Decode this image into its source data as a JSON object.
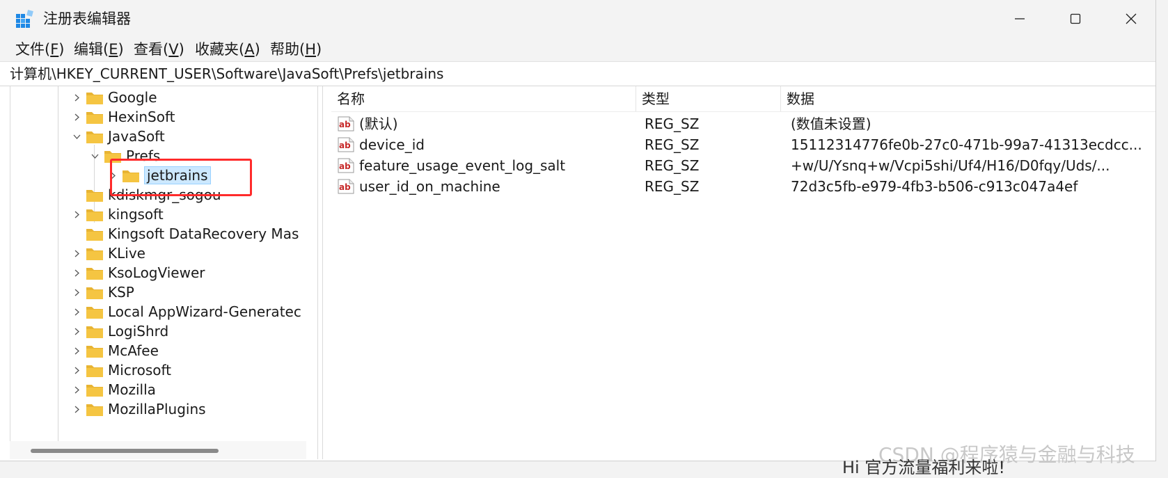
{
  "window": {
    "title": "注册表编辑器",
    "controls": {
      "minimize": "minimize",
      "maximize": "maximize",
      "close": "close"
    }
  },
  "menu": [
    {
      "label": "文件(",
      "key": "F",
      "end": ")"
    },
    {
      "label": "编辑(",
      "key": "E",
      "end": ")"
    },
    {
      "label": "查看(",
      "key": "V",
      "end": ")"
    },
    {
      "label": "收藏夹(",
      "key": "A",
      "end": ")"
    },
    {
      "label": "帮助(",
      "key": "H",
      "end": ")"
    }
  ],
  "address": "计算机\\HKEY_CURRENT_USER\\Software\\JavaSoft\\Prefs\\jetbrains",
  "tree": [
    {
      "label": "Google",
      "expander": "collapsed",
      "level": 0,
      "selected": false
    },
    {
      "label": "HexinSoft",
      "expander": "collapsed",
      "level": 0,
      "selected": false
    },
    {
      "label": "JavaSoft",
      "expander": "expanded",
      "level": 0,
      "selected": false
    },
    {
      "label": "Prefs",
      "expander": "expanded",
      "level": 1,
      "selected": false
    },
    {
      "label": "jetbrains",
      "expander": "collapsed",
      "level": 2,
      "selected": true
    },
    {
      "label": "kdiskmgr_sogou",
      "expander": "none",
      "level": 0,
      "selected": false
    },
    {
      "label": "kingsoft",
      "expander": "collapsed",
      "level": 0,
      "selected": false
    },
    {
      "label": "Kingsoft DataRecovery Mas",
      "expander": "none",
      "level": 0,
      "selected": false
    },
    {
      "label": "KLive",
      "expander": "collapsed",
      "level": 0,
      "selected": false
    },
    {
      "label": "KsoLogViewer",
      "expander": "collapsed",
      "level": 0,
      "selected": false
    },
    {
      "label": "KSP",
      "expander": "collapsed",
      "level": 0,
      "selected": false
    },
    {
      "label": "Local AppWizard-Generatec",
      "expander": "collapsed",
      "level": 0,
      "selected": false
    },
    {
      "label": "LogiShrd",
      "expander": "collapsed",
      "level": 0,
      "selected": false
    },
    {
      "label": "McAfee",
      "expander": "collapsed",
      "level": 0,
      "selected": false
    },
    {
      "label": "Microsoft",
      "expander": "collapsed",
      "level": 0,
      "selected": false
    },
    {
      "label": "Mozilla",
      "expander": "collapsed",
      "level": 0,
      "selected": false
    },
    {
      "label": "MozillaPlugins",
      "expander": "collapsed",
      "level": 0,
      "selected": false
    }
  ],
  "columns": {
    "name": "名称",
    "type": "类型",
    "data": "数据"
  },
  "values": [
    {
      "name": "(默认)",
      "type": "REG_SZ",
      "data": "(数值未设置)"
    },
    {
      "name": "device_id",
      "type": "REG_SZ",
      "data": "15112314776fe0b-27c0-471b-99a7-41313ecdcc..."
    },
    {
      "name": "feature_usage_event_log_salt",
      "type": "REG_SZ",
      "data": "+w/U/Ysnq+w/Vcpi5shi/Uf4/H16/D0fqy/Uds/..."
    },
    {
      "name": "user_id_on_machine",
      "type": "REG_SZ",
      "data": "72d3c5fb-e979-4fb3-b506-c913c047a4ef"
    }
  ],
  "watermark": "CSDN @程序猿与金融与科技",
  "background_snippet": "Hi 官方流量福利来啦!",
  "colors": {
    "selection_bg": "#cce8ff",
    "selection_border": "#99d1ff",
    "highlight_box": "#ff2b2b",
    "folder": "#f5c542"
  }
}
